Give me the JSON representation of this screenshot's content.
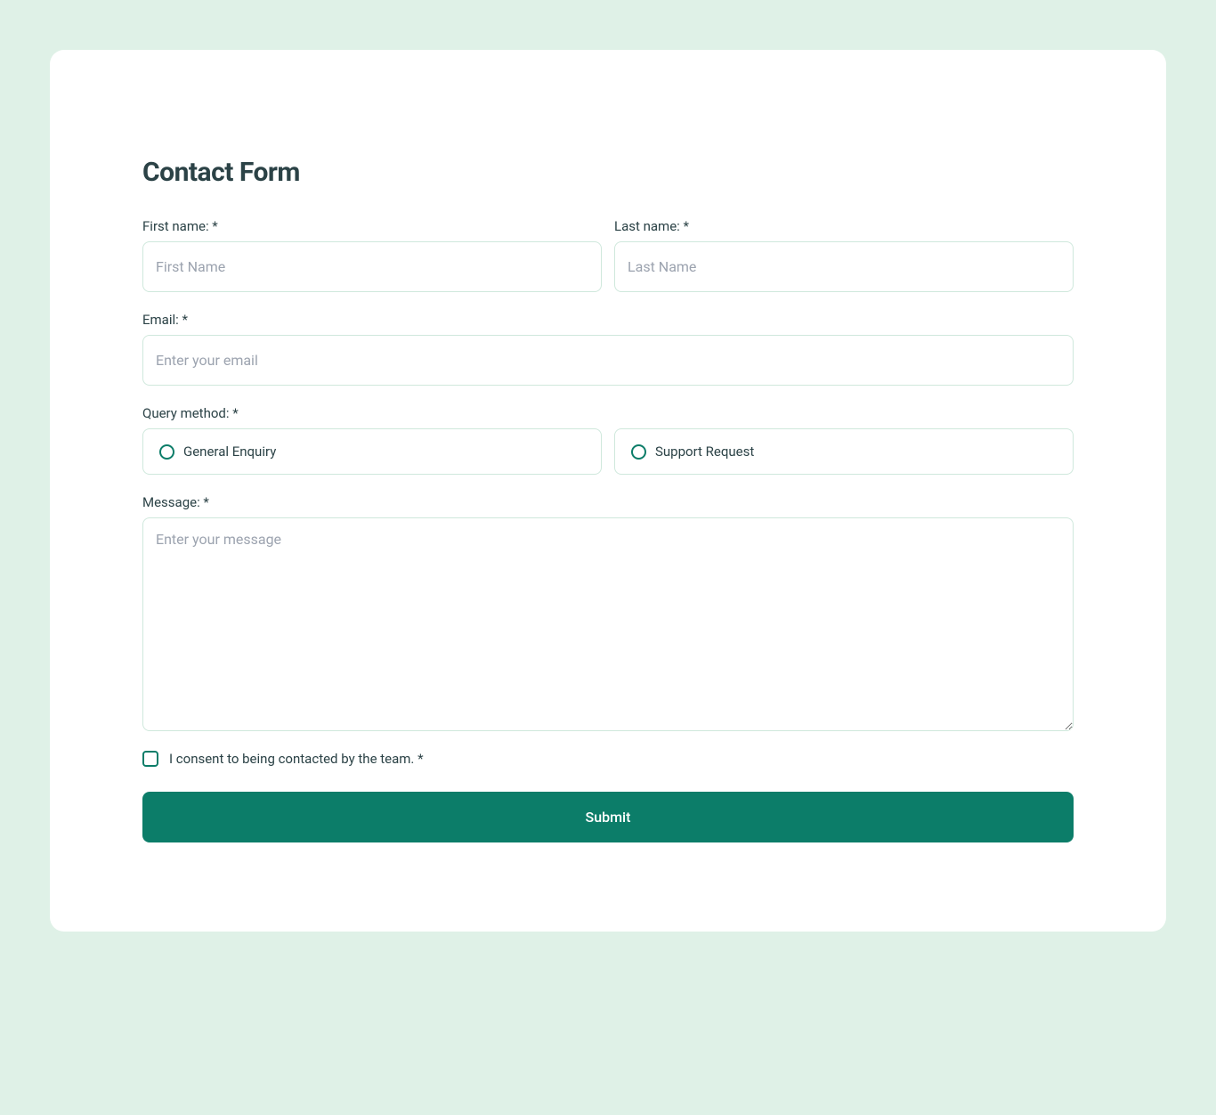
{
  "title": "Contact Form",
  "firstName": {
    "label": "First name: *",
    "placeholder": "First Name"
  },
  "lastName": {
    "label": "Last name: *",
    "placeholder": "Last Name"
  },
  "email": {
    "label": "Email: *",
    "placeholder": "Enter your email"
  },
  "queryMethod": {
    "label": "Query method: *",
    "options": [
      "General Enquiry",
      "Support Request"
    ]
  },
  "message": {
    "label": "Message: *",
    "placeholder": "Enter your message"
  },
  "consent": {
    "label": "I consent to being contacted by the team. *"
  },
  "submit": {
    "label": "Submit"
  },
  "colors": {
    "background": "#dff1e7",
    "card": "#ffffff",
    "accent": "#0c7d69",
    "text": "#2b4246",
    "border": "#cfe8dc"
  }
}
